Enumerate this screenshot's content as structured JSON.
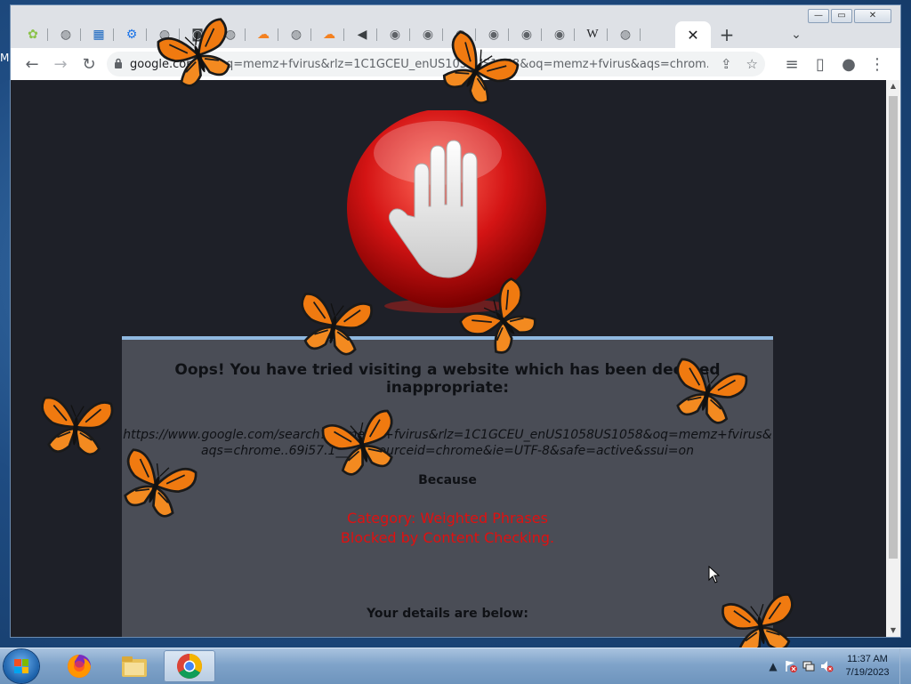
{
  "desktop": {
    "edge_letter": "M"
  },
  "browser": {
    "tabs": [
      {
        "icon": "extension-icon",
        "color": "#8bc34a"
      },
      {
        "icon": "globe-icon",
        "color": "#5f6368"
      },
      {
        "icon": "chart-icon",
        "color": "#1565c0"
      },
      {
        "icon": "gear-icon",
        "color": "#1a73e8"
      },
      {
        "icon": "globe-icon",
        "color": "#5f6368"
      },
      {
        "icon": "camera-icon",
        "color": "#3c4043"
      },
      {
        "icon": "globe-icon",
        "color": "#5f6368"
      },
      {
        "icon": "cloud-icon",
        "color": "#f48120"
      },
      {
        "icon": "globe-icon",
        "color": "#5f6368"
      },
      {
        "icon": "cloud-icon",
        "color": "#f48120"
      },
      {
        "icon": "speaker-icon",
        "color": "#3c4043"
      },
      {
        "icon": "chrome-icon",
        "color": "#5f6368"
      },
      {
        "icon": "chrome-icon",
        "color": "#5f6368"
      },
      {
        "icon": "chrome-icon",
        "color": "#5f6368"
      },
      {
        "icon": "chrome-icon",
        "color": "#5f6368"
      },
      {
        "icon": "chrome-icon",
        "color": "#5f6368"
      },
      {
        "icon": "chrome-icon",
        "color": "#5f6368"
      },
      {
        "icon": "wikipedia-icon",
        "label": "W",
        "color": "#202124"
      },
      {
        "icon": "globe-icon",
        "color": "#5f6368"
      }
    ],
    "active_tab_close": "✕",
    "new_tab": "+",
    "tab_search": "⌄",
    "window_controls": {
      "minimize": "—",
      "maximize": "▭",
      "close": "✕"
    },
    "toolbar": {
      "back": "←",
      "forward": "→",
      "reload": "↻",
      "url_host": "google.com/s",
      "url_path": "…oq=memz+fvirus&rlz=1C1GCEU_enUS1058US1058&oq=memz+fvirus&aqs=chrom...",
      "share": "⇪",
      "bookmark": "☆",
      "media": "≡",
      "sidepanel": "▯",
      "profile": "●",
      "menu": "⋮"
    }
  },
  "page": {
    "message": "Oops! You have tried visiting a website which has been deemed inappropriate:",
    "blocked_url_line1": "https://www.google.com/search?q=memz+fvirus&rlz=1C1GCEU_enUS1058US1058&oq=memz+fvirus&",
    "blocked_url_line2": "aqs=chrome..69i57.1___4&sourceid=chrome&ie=UTF-8&safe=active&ssui=on",
    "because": "Because",
    "reason_line1": "Category: Weighted Phrases",
    "reason_line2": "Blocked by Content Checking.",
    "details": "Your details are below:",
    "accent_red": "#e01010"
  },
  "taskbar": {
    "apps": [
      {
        "name": "firefox",
        "icon": "firefox-icon"
      },
      {
        "name": "explorer",
        "icon": "folder-icon"
      },
      {
        "name": "chrome",
        "icon": "chrome-icon"
      }
    ],
    "tray": {
      "time": "11:37 AM",
      "date": "7/19/2023"
    }
  }
}
